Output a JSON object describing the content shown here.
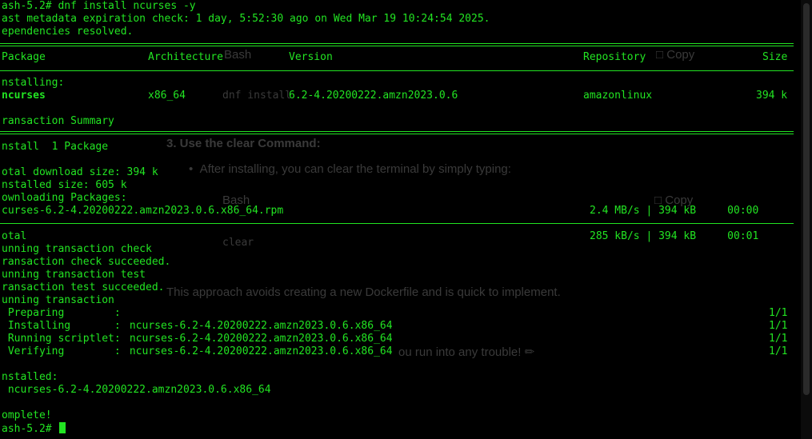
{
  "ghost": {
    "bash_label_1": "Bash",
    "copy_label_1": "Copy",
    "code_line_1": "dnf install",
    "step3_heading": "3. Use the clear Command:",
    "step3_bullet": "After installing, you can clear the terminal by simply typing:",
    "bash_label_2": "Bash",
    "copy_label_2": "Copy",
    "code_line_2": "clear",
    "approach_text": "This approach avoids creating a new Dockerfile and is quick to implement.",
    "trouble_text": "ou run into any trouble! ✏"
  },
  "terminal": {
    "line1": "ash-5.2# dnf install ncurses -y",
    "line2": "ast metadata expiration check: 1 day, 5:52:30 ago on Wed Mar 19 10:24:54 2025.",
    "line3": "ependencies resolved.",
    "table": {
      "headers": [
        "Package",
        "Architecture",
        "Version",
        "Repository",
        "Size"
      ],
      "section": "nstalling:",
      "row": [
        "ncurses",
        "x86_64",
        "6.2-4.20200222.amzn2023.0.6",
        "amazonlinux",
        "394 k"
      ]
    },
    "summary_title": "ransaction Summary",
    "install_line": "nstall  1 Package",
    "download_size": "otal download size: 394 k",
    "installed_size": "nstalled size: 605 k",
    "downloading": "ownloading Packages:",
    "rpm_file": "curses-6.2-4.20200222.amzn2023.0.6.x86_64.rpm",
    "rpm_speed": "2.4 MB/s | 394 kB     00:00",
    "total_label": "otal",
    "total_speed": "285 kB/s | 394 kB     00:01",
    "steps": [
      "unning transaction check",
      "ransaction check succeeded.",
      "unning transaction test",
      "ransaction test succeeded.",
      "unning transaction"
    ],
    "progress": [
      {
        "label": " Preparing        :",
        "pkg": "",
        "count": "1/1"
      },
      {
        "label": " Installing       :",
        "pkg": " ncurses-6.2-4.20200222.amzn2023.0.6.x86_64",
        "count": "1/1"
      },
      {
        "label": " Running scriptlet:",
        "pkg": " ncurses-6.2-4.20200222.amzn2023.0.6.x86_64",
        "count": "1/1"
      },
      {
        "label": " Verifying        :",
        "pkg": " ncurses-6.2-4.20200222.amzn2023.0.6.x86_64",
        "count": "1/1"
      }
    ],
    "installed_header": "nstalled:",
    "installed_pkg": " ncurses-6.2-4.20200222.amzn2023.0.6.x86_64",
    "complete": "omplete!",
    "prompt": "ash-5.2# "
  },
  "colors": {
    "terminal_fg": "#22e422",
    "background": "#000000",
    "ghost": "#3a3a3a"
  }
}
